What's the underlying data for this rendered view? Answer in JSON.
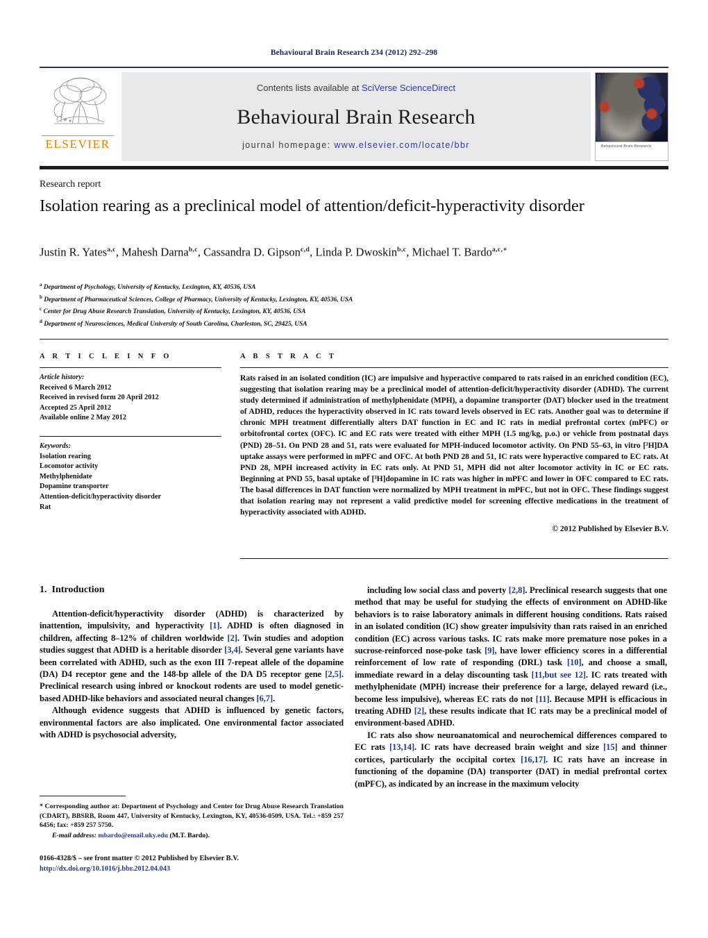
{
  "running_head": "Behavioural Brain Research 234 (2012) 292–298",
  "masthead": {
    "contents_prefix": "Contents lists available at ",
    "sciencedirect": "SciVerse ScienceDirect",
    "journal_title": "Behavioural Brain Research",
    "homepage_prefix": "journal homepage: ",
    "homepage_url": "www.elsevier.com/locate/bbr",
    "publisher_wordmark": "ELSEVIER",
    "cover_caption": "Behavioural Brain Research",
    "accent_orange": "#f07c00",
    "link_blue": "#2d3a9e",
    "band_gray": "#e9e9eb"
  },
  "article": {
    "type": "Research report",
    "title": "Isolation rearing as a preclinical model of attention/deficit-hyperactivity disorder",
    "authors": [
      {
        "name": "Justin R. Yates",
        "marks": "a,c",
        "sep": ", "
      },
      {
        "name": "Mahesh Darna",
        "marks": "b,c",
        "sep": ", "
      },
      {
        "name": "Cassandra D. Gipson",
        "marks": "c,d",
        "sep": ", "
      },
      {
        "name": "Linda P. Dwoskin",
        "marks": "b,c",
        "sep": ","
      },
      {
        "name": "Michael T. Bardo",
        "marks": "a,c,∗",
        "sep": ""
      }
    ],
    "affiliations": [
      {
        "mark": "a",
        "text": "Department of Psychology, University of Kentucky, Lexington, KY, 40536, USA"
      },
      {
        "mark": "b",
        "text": "Department of Pharmaceutical Sciences, College of Pharmacy, University of Kentucky, Lexington, KY, 40536, USA"
      },
      {
        "mark": "c",
        "text": "Center for Drug Abuse Research Translation, University of Kentucky, Lexington, KY, 40536, USA"
      },
      {
        "mark": "d",
        "text": "Department of Neurosciences, Medical University of South Carolina, Charleston, SC, 29425, USA"
      }
    ]
  },
  "info": {
    "heading": "A R T I C L E   I N F O",
    "history_label": "Article history:",
    "history": [
      "Received 6 March 2012",
      "Received in revised form 20 April 2012",
      "Accepted 25 April 2012",
      "Available online 2 May 2012"
    ],
    "keywords_label": "Keywords:",
    "keywords": [
      "Isolation rearing",
      "Locomotor activity",
      "Methylphenidate",
      "Dopamine transporter",
      "Attention-deficit/hyperactivity disorder",
      "Rat"
    ]
  },
  "abstract": {
    "heading": "A B S T R A C T",
    "text": "Rats raised in an isolated condition (IC) are impulsive and hyperactive compared to rats raised in an enriched condition (EC), suggesting that isolation rearing may be a preclinical model of attention-deficit/hyperactivity disorder (ADHD). The current study determined if administration of methylphenidate (MPH), a dopamine transporter (DAT) blocker used in the treatment of ADHD, reduces the hyperactivity observed in IC rats toward levels observed in EC rats. Another goal was to determine if chronic MPH treatment differentially alters DAT function in EC and IC rats in medial prefrontal cortex (mPFC) or orbitofrontal cortex (OFC). IC and EC rats were treated with either MPH (1.5 mg/kg, p.o.) or vehicle from postnatal days (PND) 28–51. On PND 28 and 51, rats were evaluated for MPH-induced locomotor activity. On PND 55–63, in vitro [³H]DA uptake assays were performed in mPFC and OFC. At both PND 28 and 51, IC rats were hyperactive compared to EC rats. At PND 28, MPH increased activity in EC rats only. At PND 51, MPH did not alter locomotor activity in IC or EC rats. Beginning at PND 55, basal uptake of [³H]dopamine in IC rats was higher in mPFC and lower in OFC compared to EC rats. The basal differences in DAT function were normalized by MPH treatment in mPFC, but not in OFC. These findings suggest that isolation rearing may not represent a valid predictive model for screening effective medications in the treatment of hyperactivity associated with ADHD.",
    "copyright": "© 2012 Published by Elsevier B.V."
  },
  "body": {
    "section_number": "1.",
    "section_title": "Introduction",
    "left_paragraphs": [
      "Attention-deficit/hyperactivity disorder (ADHD) is characterized by inattention, impulsivity, and hyperactivity [1]. ADHD is often diagnosed in children, affecting 8–12% of children worldwide [2]. Twin studies and adoption studies suggest that ADHD is a heritable disorder [3,4]. Several gene variants have been correlated with ADHD, such as the exon III 7-repeat allele of the dopamine (DA) D4 receptor gene and the 148-bp allele of the DA D5 receptor gene [2,5]. Preclinical research using inbred or knockout rodents are used to model genetic-based ADHD-like behaviors and associated neural changes [6,7].",
      "Although evidence suggests that ADHD is influenced by genetic factors, environmental factors are also implicated. One environmental factor associated with ADHD is psychosocial adversity,"
    ],
    "right_paragraphs": [
      "including low social class and poverty [2,8]. Preclinical research suggests that one method that may be useful for studying the effects of environment on ADHD-like behaviors is to raise laboratory animals in different housing conditions. Rats raised in an isolated condition (IC) show greater impulsivity than rats raised in an enriched condition (EC) across various tasks. IC rats make more premature nose pokes in a sucrose-reinforced nose-poke task [9], have lower efficiency scores in a differential reinforcement of low rate of responding (DRL) task [10], and choose a small, immediate reward in a delay discounting task [11,but see 12]. IC rats treated with methylphenidate (MPH) increase their preference for a large, delayed reward (i.e., become less impulsive), whereas EC rats do not [11]. Because MPH is efficacious in treating ADHD [2], these results indicate that IC rats may be a preclinical model of environment-based ADHD.",
      "IC rats also show neuroanatomical and neurochemical differences compared to EC rats [13,14]. IC rats have decreased brain weight and size [15] and thinner cortices, particularly the occipital cortex [16,17]. IC rats have an increase in functioning of the dopamine (DA) transporter (DAT) in medial prefrontal cortex (mPFC), as indicated by an increase in the maximum velocity"
    ]
  },
  "footnote": {
    "corresponding": "* Corresponding author at: Department of Psychology and Center for Drug Abuse Research Translation (CDART), BBSRB, Room 447, University of Kentucky, Lexington, KY, 40536-0509, USA. Tel.: +859 257 6456; fax: +859 257 5750.",
    "email_label": "E-mail address:",
    "email": "mbardo@email.uky.edu",
    "email_owner": "(M.T. Bardo).",
    "issn_line": "0166-4328/$ – see front matter © 2012 Published by Elsevier B.V.",
    "doi": "http://dx.doi.org/10.1016/j.bbr.2012.04.043"
  }
}
